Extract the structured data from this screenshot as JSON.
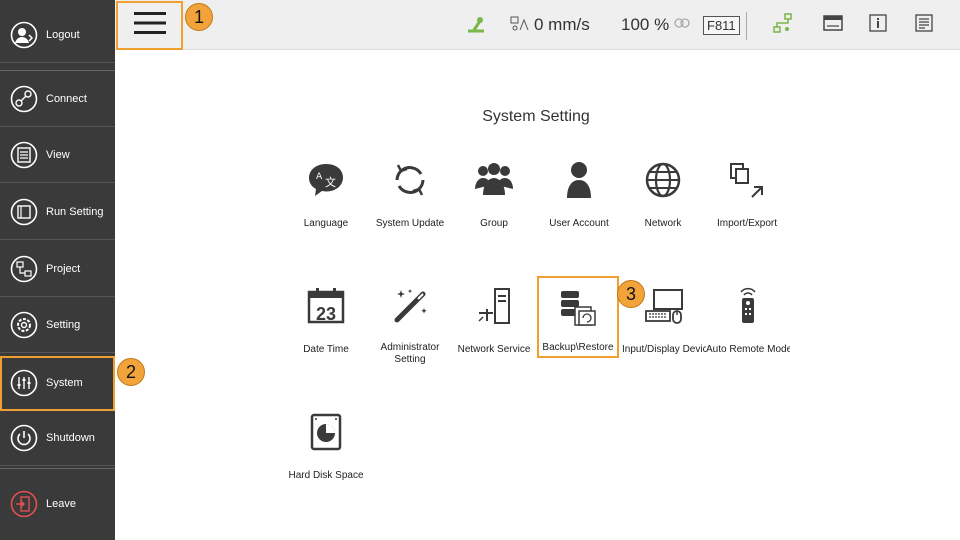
{
  "sidebar": {
    "items": [
      {
        "label": "Logout"
      },
      {
        "label": "Connect"
      },
      {
        "label": "View"
      },
      {
        "label": "Run Setting"
      },
      {
        "label": "Project"
      },
      {
        "label": "Setting"
      },
      {
        "label": "System"
      },
      {
        "label": "Shutdown"
      },
      {
        "label": "Leave"
      }
    ]
  },
  "topbar": {
    "speed": "0 mm/s",
    "percent": "100 %",
    "code": "F811"
  },
  "main": {
    "title": "System Setting",
    "tiles": [
      {
        "label": "Language"
      },
      {
        "label": "System Update"
      },
      {
        "label": "Group"
      },
      {
        "label": "User Account"
      },
      {
        "label": "Network"
      },
      {
        "label": "Import/Export"
      },
      {
        "label": "Date Time"
      },
      {
        "label": "Administrator Setting"
      },
      {
        "label": "Network Service"
      },
      {
        "label": "Backup\\Restore"
      },
      {
        "label": "Input/Display Device"
      },
      {
        "label": "Auto Remote Mode"
      },
      {
        "label": "Hard Disk Space"
      }
    ],
    "date_icon_number": "23"
  },
  "annotations": {
    "one": "1",
    "two": "2",
    "three": "3"
  },
  "colors": {
    "highlight": "#f0a030",
    "sidebar_bg": "#3a3a3a",
    "accent_green": "#7ab648"
  }
}
